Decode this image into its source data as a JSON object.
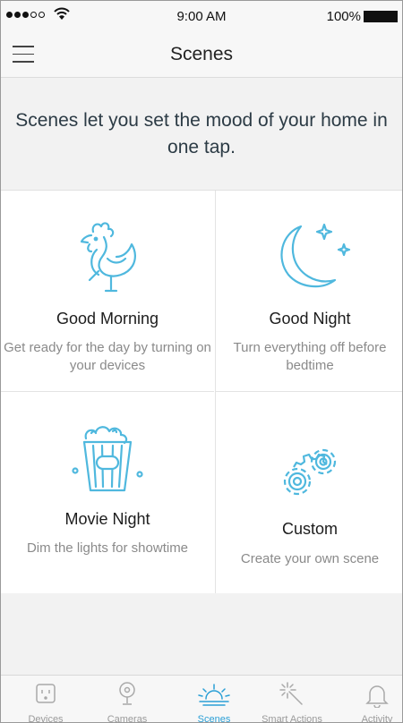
{
  "status_bar": {
    "time": "9:00 AM",
    "battery": "100%"
  },
  "nav": {
    "title": "Scenes",
    "menu_icon": "hamburger-menu-icon"
  },
  "intro": {
    "text": "Scenes let you set the mood of your home in one tap."
  },
  "scenes": [
    {
      "title": "Good Morning",
      "description": "Get ready for the day by turning on your devices",
      "icon": "rooster-icon"
    },
    {
      "title": "Good Night",
      "description": "Turn everything off before bedtime",
      "icon": "moon-stars-icon"
    },
    {
      "title": "Movie Night",
      "description": "Dim the lights for showtime",
      "icon": "popcorn-icon"
    },
    {
      "title": "Custom",
      "description": "Create your own scene",
      "icon": "gears-icon"
    }
  ],
  "tabs": [
    {
      "label": "Devices",
      "icon": "outlet-icon",
      "active": false
    },
    {
      "label": "Cameras",
      "icon": "camera-icon",
      "active": false
    },
    {
      "label": "Scenes",
      "icon": "sunrise-icon",
      "active": true
    },
    {
      "label": "Smart Actions",
      "icon": "magic-wand-icon",
      "active": false
    },
    {
      "label": "Activity",
      "icon": "bell-icon",
      "active": false
    }
  ],
  "colors": {
    "icon_blue": "#4fb8de",
    "active_tab": "#2a9fd6",
    "inactive_tab": "#9a9a9a"
  }
}
